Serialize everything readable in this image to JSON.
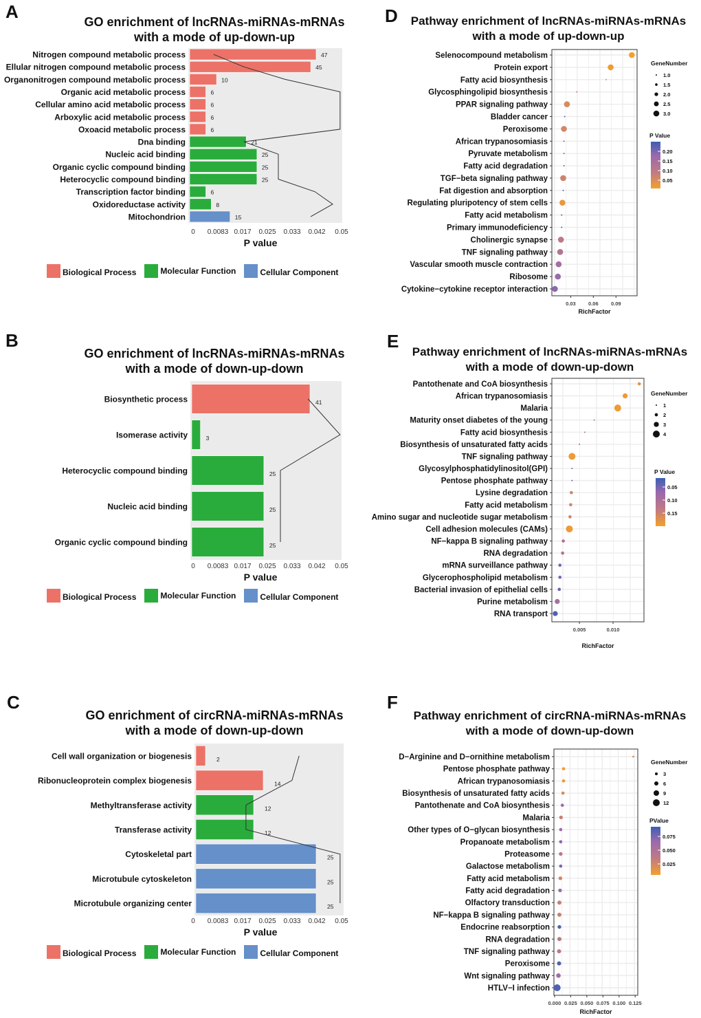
{
  "figure": {
    "panels": [
      "A",
      "B",
      "C",
      "D",
      "E",
      "F"
    ]
  },
  "colors": {
    "biological_process": "#ec7268",
    "molecular_function": "#2aac3c",
    "cellular_component": "#6590c9",
    "plot_bg": "#ebebeb",
    "pval_high": "#3b5fb4",
    "pval_mid": "#9a69ad",
    "pval_low": "#f4a02a"
  },
  "go_legend": {
    "items": [
      {
        "label": "Biological Process",
        "category": "BP"
      },
      {
        "label": "Molecular Function",
        "category": "MF"
      },
      {
        "label": "Cellular Component",
        "category": "CC"
      }
    ]
  },
  "chart_data": [
    {
      "panel": "A",
      "type": "bar",
      "title": "GO enrichment of lncRNAs-miRNAs-mRNAs",
      "subtitle": "with a mode of up-down-up",
      "xlabel": "P value",
      "xticks": [
        "0",
        "0.0083",
        "0.017",
        "0.025",
        "0.033",
        "0.042",
        "0.05"
      ],
      "xlim": [
        0,
        0.05
      ],
      "bar_value_name": "Gene count",
      "line_value_name": "P value",
      "categories": [
        "Nitrogen compound metabolic process",
        "Ellular nitrogen compound metabolic process",
        "Organonitrogen compound metabolic process",
        "Organic acid metabolic process",
        "Cellular amino acid metabolic process",
        "Arboxylic acid metabolic process",
        "Oxoacid metabolic process",
        "Dna binding",
        "Nucleic acid binding",
        "Organic cyclic compound binding",
        "Heterocyclic compound binding",
        "Transcription factor binding",
        "Oxidoreductase activity",
        "Mitochondrion"
      ],
      "groups": [
        "BP",
        "BP",
        "BP",
        "BP",
        "BP",
        "BP",
        "BP",
        "MF",
        "MF",
        "MF",
        "MF",
        "MF",
        "MF",
        "CC"
      ],
      "values": [
        47,
        45,
        10,
        6,
        6,
        6,
        6,
        21,
        25,
        25,
        25,
        6,
        8,
        15
      ],
      "pvalues": [
        0.0069,
        0.0171,
        0.031,
        0.0495,
        0.0495,
        0.0495,
        0.0495,
        0.0171,
        0.0287,
        0.0287,
        0.0287,
        0.041,
        0.047,
        0.0396
      ]
    },
    {
      "panel": "B",
      "type": "bar",
      "title": "GO enrichment of lncRNAs-miRNAs-mRNAs",
      "subtitle": "with a mode of down-up-down",
      "xlabel": "P value",
      "xticks": [
        "0",
        "0.0083",
        "0.017",
        "0.025",
        "0.033",
        "0.042",
        "0.05"
      ],
      "xlim": [
        0,
        0.05
      ],
      "bar_value_name": "Gene count",
      "line_value_name": "P value",
      "categories": [
        "Biosynthetic process",
        "Isomerase activity",
        "Heterocyclic compound binding",
        "Nucleic acid binding",
        "Organic cyclic compound binding"
      ],
      "groups": [
        "BP",
        "MF",
        "MF",
        "MF",
        "MF"
      ],
      "values": [
        41,
        3,
        25,
        25,
        25
      ],
      "pvalues": [
        0.0387,
        0.0495,
        0.0294,
        0.0294,
        0.0294
      ]
    },
    {
      "panel": "C",
      "type": "bar",
      "title": "GO enrichment of circRNA-miRNAs-mRNAs",
      "subtitle": "with a mode of down-up-down",
      "xlabel": "P value",
      "xticks": [
        "0",
        "0.0083",
        "0.017",
        "0.025",
        "0.033",
        "0.042",
        "0.05"
      ],
      "xlim": [
        0,
        0.05
      ],
      "bar_value_name": "Gene count",
      "line_value_name": "P value",
      "categories": [
        "Cell wall organization or biogenesis",
        "Ribonucleoprotein complex biogenesis",
        "Methyltransferase activity",
        "Transferase activity",
        "Cytoskeletal part",
        "Microtubule cytoskeleton",
        "Microtubule organizing center"
      ],
      "groups": [
        "BP",
        "BP",
        "MF",
        "MF",
        "CC",
        "CC",
        "CC"
      ],
      "values": [
        2,
        14,
        12,
        12,
        25,
        25,
        25
      ],
      "pvalues": [
        0.0357,
        0.0333,
        0.0178,
        0.0178,
        0.0495,
        0.0495,
        0.0495
      ]
    },
    {
      "panel": "D",
      "type": "scatter",
      "title": "Pathway enrichment of lncRNAs-miRNAs-mRNAs",
      "subtitle": "with a mode of up-down-up",
      "xlabel": "RichFactor",
      "xticks": [
        0.03,
        0.06,
        0.09
      ],
      "xtick_labels": [
        "0.03",
        "0.06",
        "0.09"
      ],
      "xlim": [
        0.005,
        0.118
      ],
      "size_legend_title": "GeneNumber",
      "size_legend": [
        "1.0",
        "1.5",
        "2.0",
        "2.5",
        "3.0"
      ],
      "size_legend_values": [
        1.0,
        1.5,
        2.0,
        2.5,
        3.0
      ],
      "color_legend_title": "P Value",
      "color_legend": [
        "0.20",
        "0.15",
        "0.10",
        "0.05"
      ],
      "color_legend_values": [
        0.2,
        0.15,
        0.1,
        0.05
      ],
      "color_range": [
        0.01,
        0.24
      ],
      "color_reversed": false,
      "categories": [
        "Selenocompound metabolism",
        "Protein export",
        "Fatty acid biosynthesis",
        "Glycosphingolipid biosynthesis",
        "PPAR signaling pathway",
        "Bladder cancer",
        "Peroxisome",
        "African trypanosomiasis",
        "Pyruvate metabolism",
        "Fatty acid degradation",
        "TGF−beta signaling pathway",
        "Fat digestion and absorption",
        "Regulating pluripotency of stem cells",
        "Fatty acid metabolism",
        "Primary immunodeficiency",
        "Cholinergic synapse",
        "TNF signaling pathway",
        "Vascular smooth muscle contraction",
        "Ribosome",
        "Cytokine−cytokine receptor interaction"
      ],
      "x": [
        0.111,
        0.083,
        0.077,
        0.038,
        0.025,
        0.022,
        0.021,
        0.021,
        0.021,
        0.021,
        0.02,
        0.02,
        0.019,
        0.018,
        0.018,
        0.017,
        0.016,
        0.014,
        0.013,
        0.009
      ],
      "gene_number": [
        3,
        3,
        1,
        1,
        3,
        1,
        3,
        1,
        1,
        1,
        3,
        1,
        3,
        1,
        1,
        3,
        3,
        3,
        3,
        3
      ],
      "pvalue": [
        0.01,
        0.02,
        0.04,
        0.09,
        0.06,
        0.22,
        0.07,
        0.21,
        0.21,
        0.22,
        0.08,
        0.23,
        0.03,
        0.23,
        0.23,
        0.11,
        0.13,
        0.16,
        0.18,
        0.19
      ]
    },
    {
      "panel": "E",
      "type": "scatter",
      "title": "Pathway enrichment of lncRNAs-miRNAs-mRNAs",
      "subtitle": "with a mode of down-up-down",
      "xlabel": "RichFactor",
      "xticks": [
        0.005,
        0.01
      ],
      "xtick_labels": [
        "0.005",
        "0.010"
      ],
      "xlim": [
        0.0009,
        0.0146
      ],
      "size_legend_title": "GeneNumber",
      "size_legend": [
        "1",
        "2",
        "3",
        "4"
      ],
      "size_legend_values": [
        1,
        2,
        3,
        4
      ],
      "color_legend_title": "P Value",
      "color_legend": [
        "0.05",
        "0.10",
        "0.15"
      ],
      "color_legend_values": [
        0.05,
        0.1,
        0.15
      ],
      "color_range": [
        0.01,
        0.19
      ],
      "color_reversed": true,
      "categories": [
        "Pantothenate and CoA biosynthesis",
        "African trypanosomiasis",
        "Malaria",
        "Maturity onset diabetes of the young",
        "Fatty acid biosynthesis",
        "Biosynthesis of unsaturated fatty acids",
        "TNF signaling pathway",
        "Glycosylphosphatidylinositol(GPI)",
        "Pentose phosphate pathway",
        "Lysine degradation",
        "Fatty acid metabolism",
        "Amino sugar and nucleotide sugar metabolism",
        "Cell adhesion molecules (CAMs)",
        "NF−kappa B signaling pathway",
        "RNA degradation",
        "mRNA surveillance pathway",
        "Glycerophospholipid metabolism",
        "Bacterial invasion of epithelial cells",
        "Purine metabolism",
        "RNA transport"
      ],
      "x": [
        0.0139,
        0.0118,
        0.0107,
        0.0072,
        0.0058,
        0.005,
        0.0039,
        0.0039,
        0.0039,
        0.0038,
        0.0037,
        0.0036,
        0.0035,
        0.0026,
        0.0025,
        0.0021,
        0.0021,
        0.002,
        0.0017,
        0.0014
      ],
      "gene_number": [
        2,
        3,
        4,
        1,
        1,
        1,
        4,
        1,
        1,
        2,
        2,
        2,
        4,
        2,
        2,
        2,
        2,
        2,
        3,
        3
      ],
      "pvalue": [
        0.17,
        0.18,
        0.18,
        0.09,
        0.08,
        0.06,
        0.18,
        0.03,
        0.03,
        0.14,
        0.14,
        0.14,
        0.18,
        0.09,
        0.09,
        0.04,
        0.04,
        0.03,
        0.08,
        0.02
      ]
    },
    {
      "panel": "F",
      "type": "scatter",
      "title": "Pathway enrichment of circRNA-miRNAs-mRNAs",
      "subtitle": "with a mode of down-up-down",
      "xlabel": "RichFactor",
      "xticks": [
        0.0,
        0.025,
        0.05,
        0.075,
        0.1,
        0.125
      ],
      "xtick_labels": [
        "0.000",
        "0.025",
        "0.050",
        "0.075",
        "0.100",
        "0.125"
      ],
      "xlim": [
        -0.001,
        0.129
      ],
      "size_legend_title": "GeneNumber",
      "size_legend": [
        "3",
        "6",
        "9",
        "12"
      ],
      "size_legend_values": [
        3,
        6,
        9,
        12
      ],
      "color_legend_title": "PValue",
      "color_legend": [
        "0.075",
        "0.050",
        "0.025"
      ],
      "color_legend_values": [
        0.075,
        0.05,
        0.025
      ],
      "color_range": [
        0.005,
        0.095
      ],
      "color_reversed": false,
      "categories": [
        "D−Arginine and D−ornithine metabolism",
        "Pentose phosphate pathway",
        "African trypanosomiasis",
        "Biosynthesis of unsaturated fatty acids",
        "Pantothenate and CoA biosynthesis",
        "Malaria",
        "Other types of O−glycan biosynthesis",
        "Propanoate metabolism",
        "Proteasome",
        "Galactose metabolism",
        "Fatty acid metabolism",
        "Fatty acid degradation",
        "Olfactory transduction",
        "NF−kappa B signaling pathway",
        "Endocrine  reabsorption",
        "RNA degradation",
        "TNF signaling pathway",
        "Peroxisome",
        "Wnt signaling pathway",
        "HTLV−I infection"
      ],
      "x": [
        0.122,
        0.014,
        0.014,
        0.013,
        0.012,
        0.01,
        0.0095,
        0.0095,
        0.0095,
        0.0095,
        0.009,
        0.0085,
        0.0075,
        0.0075,
        0.0075,
        0.0075,
        0.007,
        0.007,
        0.006,
        0.004
      ],
      "gene_number": [
        1,
        4,
        4,
        4,
        4,
        5,
        4,
        4,
        5,
        4,
        5,
        5,
        6,
        6,
        5,
        6,
        6,
        6,
        7,
        12
      ],
      "pvalue": [
        0.02,
        0.008,
        0.01,
        0.025,
        0.07,
        0.035,
        0.07,
        0.075,
        0.045,
        0.08,
        0.03,
        0.07,
        0.035,
        0.035,
        0.09,
        0.045,
        0.045,
        0.09,
        0.065,
        0.09
      ]
    }
  ]
}
